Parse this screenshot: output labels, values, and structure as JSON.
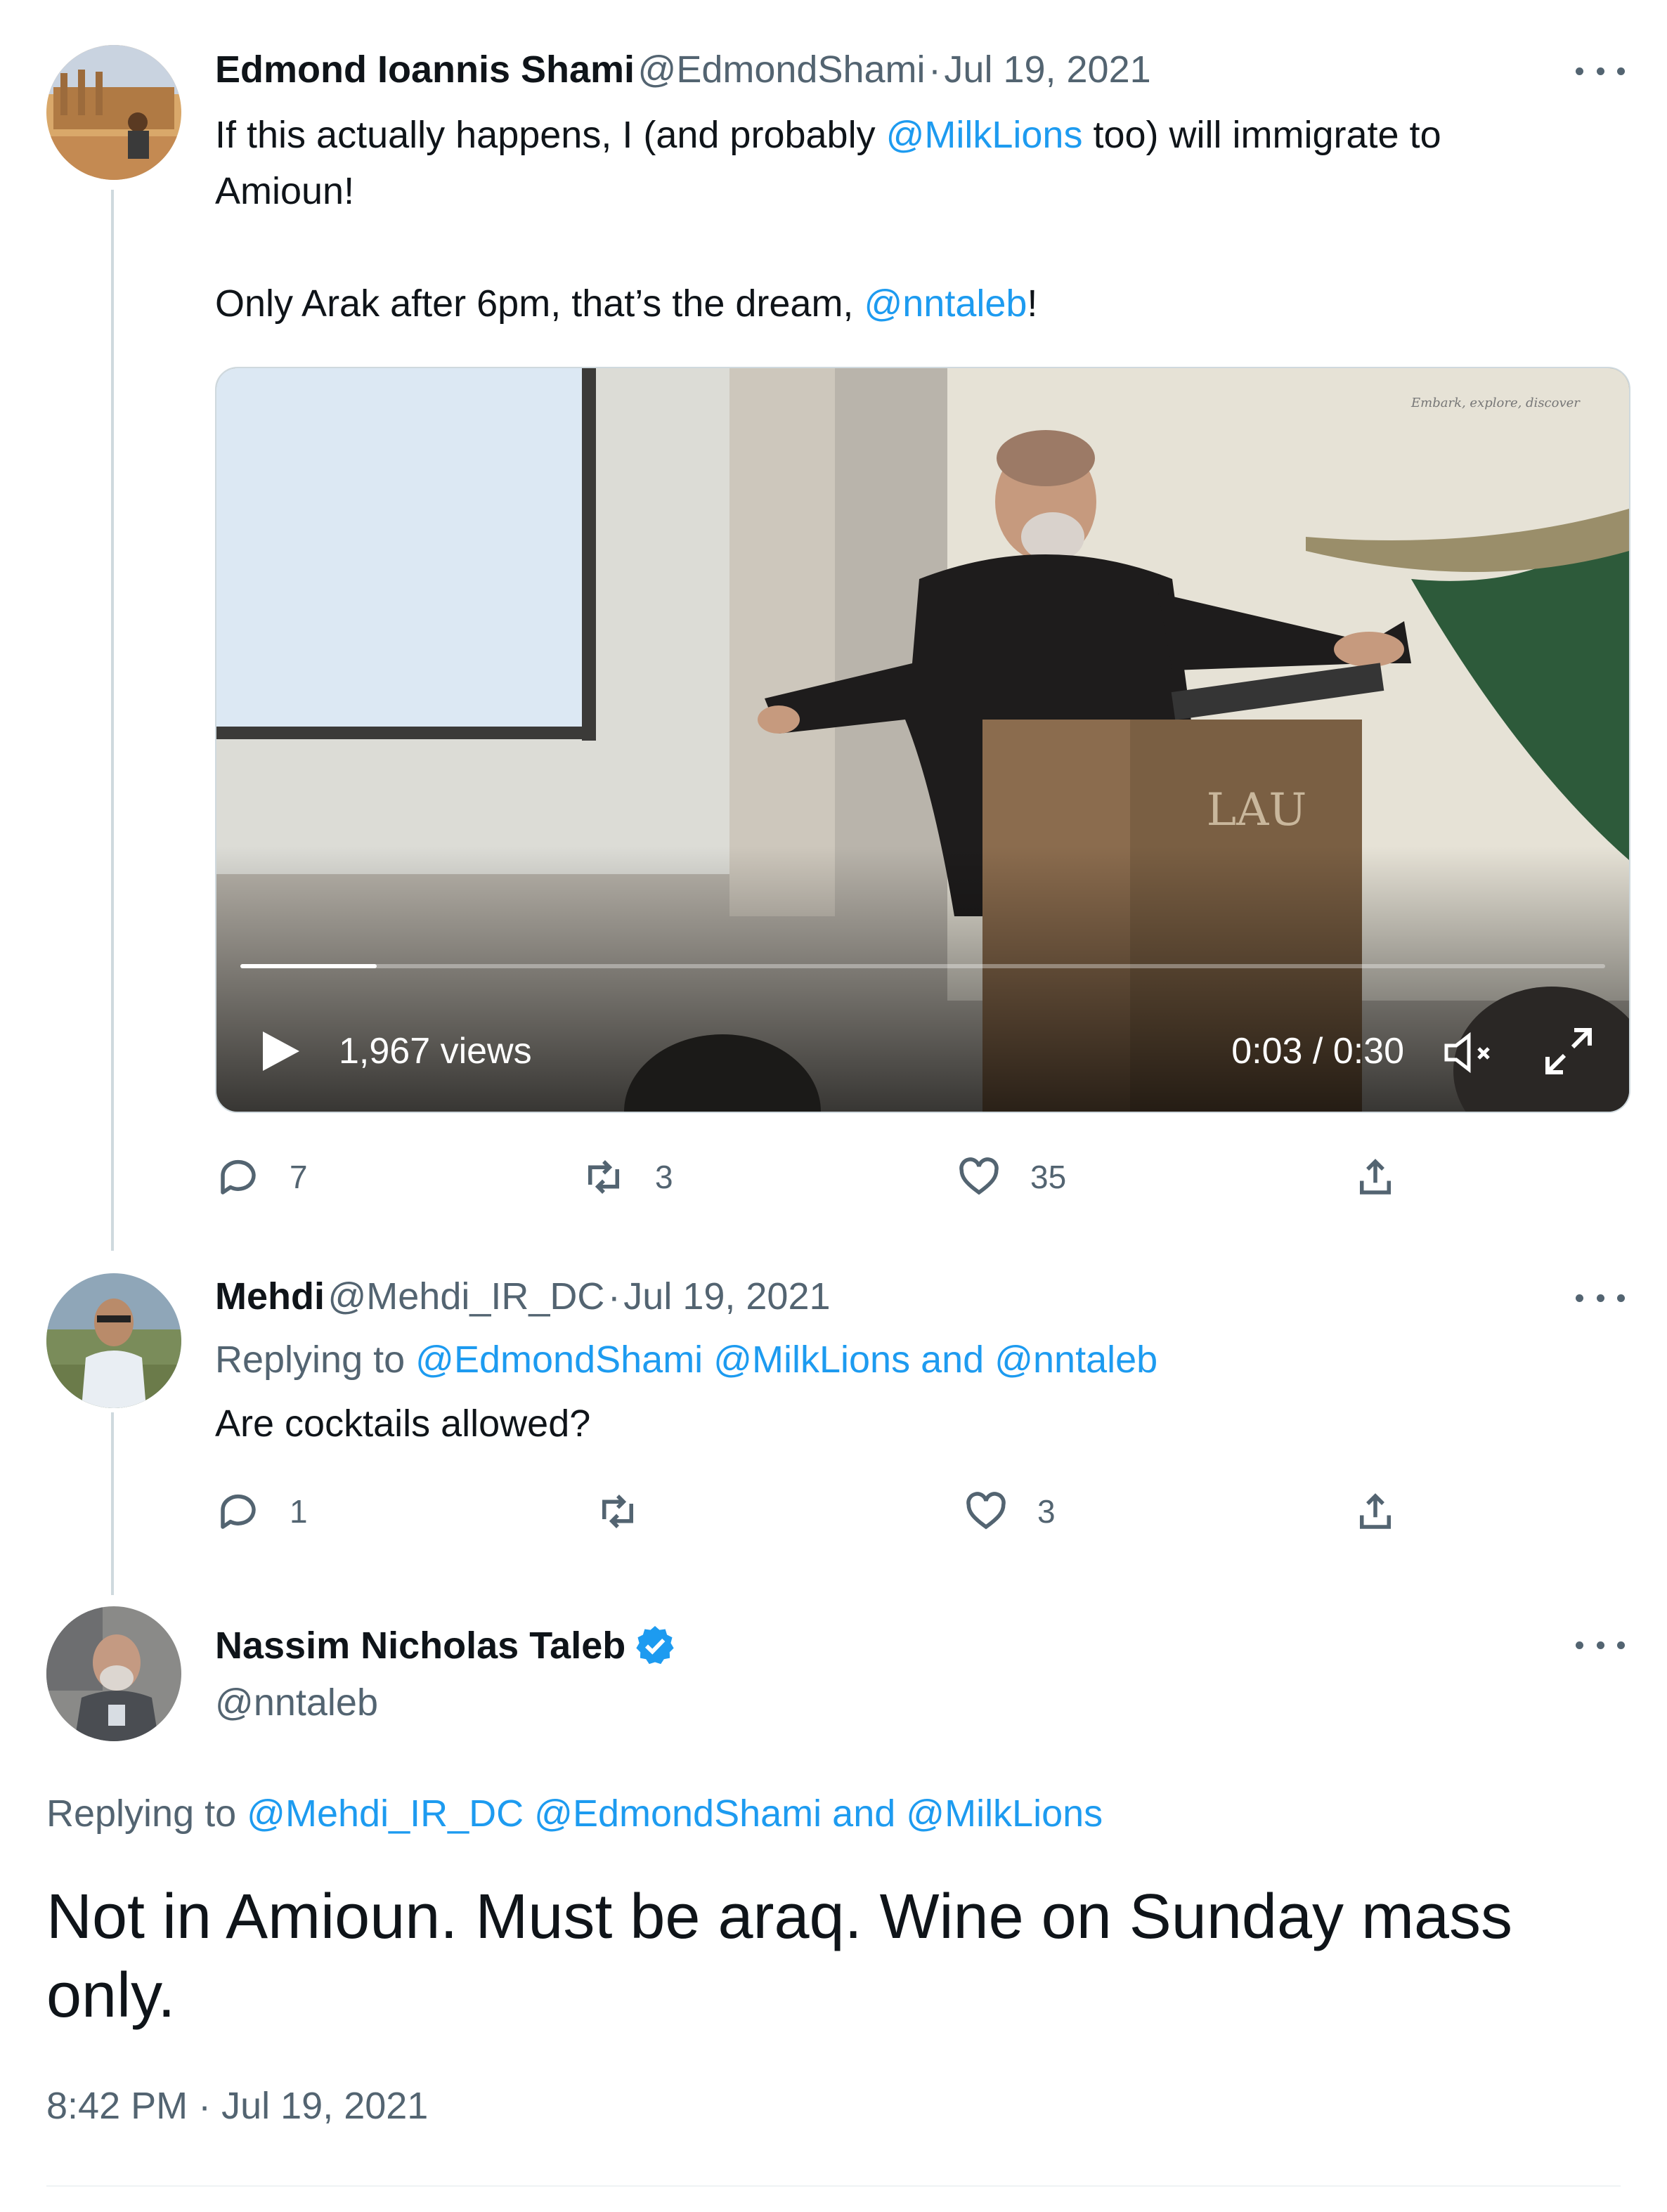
{
  "tweet1": {
    "name": "Edmond Ioannis Shami",
    "handle": "@EdmondShami",
    "sep": "·",
    "date": "Jul 19, 2021",
    "line1_a": "If this actually happens, I (and probably ",
    "line1_link": "@MilkLions",
    "line1_b": " too) will immigrate to",
    "line2": "Amioun!",
    "line3_a": "Only Arak after 6pm, that’s the dream, ",
    "line3_link": "@nntaleb",
    "line3_b": "!",
    "video": {
      "views": "1,967 views",
      "time": "0:03 / 0:30",
      "progress": 0.1,
      "banner_text": "Embark, explore, discover",
      "podium_text": "LAU"
    },
    "replies": "7",
    "retweets": "3",
    "likes": "35"
  },
  "tweet2": {
    "name": "Mehdi",
    "handle": "@Mehdi_IR_DC",
    "sep": "·",
    "date": "Jul 19, 2021",
    "replying_label": "Replying to ",
    "replying_1": "@EdmondShami",
    "replying_2": "@MilkLions",
    "replying_and": " and ",
    "replying_3": "@nntaleb",
    "text": "Are cocktails allowed?",
    "replies": "1",
    "retweets": "",
    "likes": "3"
  },
  "tweet3": {
    "name": "Nassim Nicholas Taleb",
    "handle": "@nntaleb",
    "replying_label": "Replying to ",
    "replying_1": "@Mehdi_IR_DC",
    "replying_2": "@EdmondShami",
    "replying_and": " and ",
    "replying_3": "@MilkLions",
    "text_line1": "Not in Amioun. Must be araq. Wine on Sunday mass",
    "text_line2": "only.",
    "timestamp": "8:42 PM · Jul 19, 2021"
  },
  "colors": {
    "link": "#1d9bf0",
    "secondary": "#536471",
    "verified": "#1d9bf0"
  },
  "icons": [
    "reply-icon",
    "retweet-icon",
    "like-icon",
    "share-icon",
    "more-icon",
    "play-icon",
    "mute-icon",
    "fullscreen-icon",
    "verified-badge-icon"
  ]
}
